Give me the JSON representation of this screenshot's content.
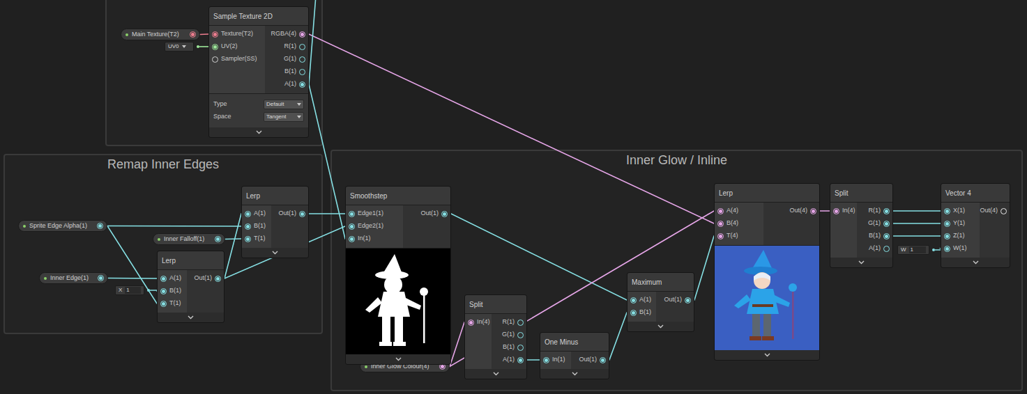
{
  "groups": [
    {
      "title": ""
    },
    {
      "title": "Remap Inner Edges"
    },
    {
      "title": "Inner Glow / Inline"
    }
  ],
  "properties": [
    {
      "label": "Main Texture(T2)",
      "color": "#ee7d8f"
    },
    {
      "label": "Sprite Edge Alpha(1)",
      "color": "#86e0e4"
    },
    {
      "label": "Inner Falloff(1)",
      "color": "#86e0e4"
    },
    {
      "label": "Inner Edge(1)",
      "color": "#86e0e4"
    },
    {
      "label": "Inner Glow Colour(4)",
      "color": "#e6a6e8"
    }
  ],
  "fields": [
    {
      "kind": "dropdown",
      "label": "UV0",
      "value": "",
      "color": "#9ee89a"
    },
    {
      "kind": "number",
      "label": "X",
      "value": "1",
      "color": "#86e0e4"
    },
    {
      "kind": "number",
      "label": "W",
      "value": "1",
      "color": "#86e0e4"
    }
  ],
  "nodes": [
    {
      "title": "Sample Texture 2D",
      "inputs": [
        {
          "label": "Texture(T2)",
          "connected": true,
          "color": "#ee7d8f"
        },
        {
          "label": "UV(2)",
          "connected": true,
          "color": "#9ee89a"
        },
        {
          "label": "Sampler(SS)",
          "connected": false,
          "color": "#cfcfcf"
        }
      ],
      "outputs": [
        {
          "label": "RGBA(4)",
          "connected": true,
          "color": "#e6a6e8"
        },
        {
          "label": "R(1)",
          "connected": false,
          "color": "#86e0e4"
        },
        {
          "label": "G(1)",
          "connected": false,
          "color": "#86e0e4"
        },
        {
          "label": "B(1)",
          "connected": false,
          "color": "#86e0e4"
        },
        {
          "label": "A(1)",
          "connected": true,
          "color": "#86e0e4"
        }
      ],
      "settings": [
        {
          "label": "Type",
          "value": "Default"
        },
        {
          "label": "Space",
          "value": "Tangent"
        }
      ],
      "preview": "none"
    },
    {
      "title": "Lerp",
      "inputs": [
        {
          "label": "A(1)",
          "connected": true,
          "color": "#86e0e4"
        },
        {
          "label": "B(1)",
          "connected": true,
          "color": "#86e0e4"
        },
        {
          "label": "T(1)",
          "connected": true,
          "color": "#86e0e4"
        }
      ],
      "outputs": [
        {
          "label": "Out(1)",
          "connected": true,
          "color": "#86e0e4"
        }
      ],
      "settings": [],
      "preview": "none"
    },
    {
      "title": "Lerp",
      "inputs": [
        {
          "label": "A(1)",
          "connected": true,
          "color": "#86e0e4"
        },
        {
          "label": "B(1)",
          "connected": true,
          "color": "#86e0e4"
        },
        {
          "label": "T(1)",
          "connected": true,
          "color": "#86e0e4"
        }
      ],
      "outputs": [
        {
          "label": "Out(1)",
          "connected": true,
          "color": "#86e0e4"
        }
      ],
      "settings": [],
      "preview": "none"
    },
    {
      "title": "Smoothstep",
      "inputs": [
        {
          "label": "Edge1(1)",
          "connected": true,
          "color": "#86e0e4"
        },
        {
          "label": "Edge2(1)",
          "connected": true,
          "color": "#86e0e4"
        },
        {
          "label": "In(1)",
          "connected": true,
          "color": "#86e0e4"
        }
      ],
      "outputs": [
        {
          "label": "Out(1)",
          "connected": true,
          "color": "#86e0e4"
        }
      ],
      "settings": [],
      "preview": "silhouette"
    },
    {
      "title": "Split",
      "inputs": [
        {
          "label": "In(4)",
          "connected": true,
          "color": "#e6a6e8"
        }
      ],
      "outputs": [
        {
          "label": "R(1)",
          "connected": false,
          "color": "#86e0e4"
        },
        {
          "label": "G(1)",
          "connected": false,
          "color": "#86e0e4"
        },
        {
          "label": "B(1)",
          "connected": false,
          "color": "#86e0e4"
        },
        {
          "label": "A(1)",
          "connected": true,
          "color": "#86e0e4"
        }
      ],
      "settings": [],
      "preview": "none"
    },
    {
      "title": "One Minus",
      "inputs": [
        {
          "label": "In(1)",
          "connected": true,
          "color": "#86e0e4"
        }
      ],
      "outputs": [
        {
          "label": "Out(1)",
          "connected": true,
          "color": "#86e0e4"
        }
      ],
      "settings": [],
      "preview": "none"
    },
    {
      "title": "Maximum",
      "inputs": [
        {
          "label": "A(1)",
          "connected": true,
          "color": "#86e0e4"
        },
        {
          "label": "B(1)",
          "connected": true,
          "color": "#86e0e4"
        }
      ],
      "outputs": [
        {
          "label": "Out(1)",
          "connected": true,
          "color": "#86e0e4"
        }
      ],
      "settings": [],
      "preview": "none"
    },
    {
      "title": "Lerp",
      "inputs": [
        {
          "label": "A(4)",
          "connected": true,
          "color": "#e6a6e8"
        },
        {
          "label": "B(4)",
          "connected": true,
          "color": "#e6a6e8"
        },
        {
          "label": "T(4)",
          "connected": true,
          "color": "#e6a6e8"
        }
      ],
      "outputs": [
        {
          "label": "Out(4)",
          "connected": true,
          "color": "#e6a6e8"
        }
      ],
      "settings": [],
      "preview": "wizard"
    },
    {
      "title": "Split",
      "inputs": [
        {
          "label": "In(4)",
          "connected": true,
          "color": "#e6a6e8"
        }
      ],
      "outputs": [
        {
          "label": "R(1)",
          "connected": true,
          "color": "#86e0e4"
        },
        {
          "label": "G(1)",
          "connected": true,
          "color": "#86e0e4"
        },
        {
          "label": "B(1)",
          "connected": true,
          "color": "#86e0e4"
        },
        {
          "label": "A(1)",
          "connected": false,
          "color": "#86e0e4"
        }
      ],
      "settings": [],
      "preview": "none"
    },
    {
      "title": "Vector 4",
      "inputs": [
        {
          "label": "X(1)",
          "connected": true,
          "color": "#86e0e4"
        },
        {
          "label": "Y(1)",
          "connected": true,
          "color": "#86e0e4"
        },
        {
          "label": "Z(1)",
          "connected": true,
          "color": "#86e0e4"
        },
        {
          "label": "W(1)",
          "connected": true,
          "color": "#86e0e4"
        }
      ],
      "outputs": [
        {
          "label": "Out(4)",
          "connected": false,
          "color": "#e8e8e8"
        }
      ],
      "settings": [],
      "preview": "none"
    }
  ]
}
